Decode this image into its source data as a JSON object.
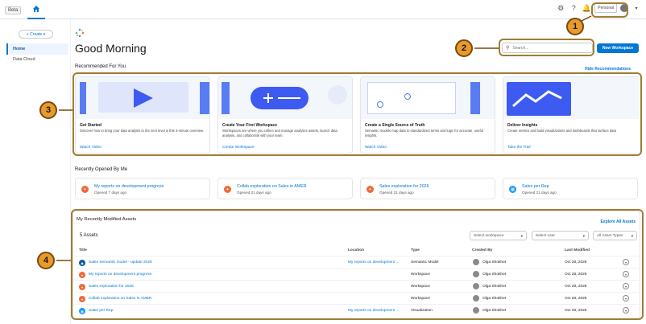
{
  "topbar": {
    "beta": "Beta",
    "personal": "Personal"
  },
  "sidebar": {
    "create": "+ Create",
    "items": [
      {
        "label": "Home"
      },
      {
        "label": "Data Cloud"
      }
    ]
  },
  "greeting": "Good Morning",
  "search": {
    "placeholder": "Search..."
  },
  "new_workspace": "New Workspace",
  "recommended": {
    "title": "Recommended For You",
    "hide": "Hide Recommendations",
    "cards": [
      {
        "title": "Get Started",
        "desc": "Discover how to bring your data analysis to the next level in this 3-minute overview.",
        "link": "Watch Video"
      },
      {
        "title": "Create Your First Workspace",
        "desc": "Workspaces are where you collect and manage analytics assets, launch data analysis, and collaborate with your team.",
        "link": "Create Workspace"
      },
      {
        "title": "Create a Single Source of Truth",
        "desc": "Semantic models map data to standardized terms and logic for accurate, useful insights.",
        "link": "Watch Video"
      },
      {
        "title": "Deliver Insights",
        "desc": "Create metrics and build visualizations and dashboards that surface data",
        "link": "Take the Trail"
      }
    ]
  },
  "recent": {
    "title": "Recently Opened By Me",
    "items": [
      {
        "title": "My reports on development progress",
        "sub": "Opened 7 days ago"
      },
      {
        "title": "Collab exploration on Sales in AMER",
        "sub": "Opened 21 days ago"
      },
      {
        "title": "Sales exploration for 2026",
        "sub": "Opened 21 days ago"
      },
      {
        "title": "Sales per Rep",
        "sub": "Opened 21 days ago"
      }
    ]
  },
  "assets": {
    "title": "My Recently Modified Assets",
    "explore": "Explore All Assets",
    "count": "5 Assets",
    "filters": {
      "workspace": "Select workspace",
      "user": "Select user",
      "types": "All Asset Types"
    },
    "columns": [
      "Title",
      "Location",
      "Type",
      "Created By",
      "Last Modified"
    ],
    "rows": [
      {
        "title": "Sales Semantic model - update 2026",
        "location": "My reports on development ...",
        "type": "Semantic Model",
        "created_by": "Olga Shokhet",
        "modified": "Oct 28, 2025"
      },
      {
        "title": "My reports on development progress",
        "location": "",
        "type": "Workspace",
        "created_by": "Olga Shokhet",
        "modified": "Oct 28, 2025"
      },
      {
        "title": "Sales exploration for 2026",
        "location": "",
        "type": "Workspace",
        "created_by": "Olga Shokhet",
        "modified": "Oct 28, 2025"
      },
      {
        "title": "Collab exploration on Sales in AMER",
        "location": "",
        "type": "Workspace",
        "created_by": "Olga Shokhet",
        "modified": "Oct 28, 2025"
      },
      {
        "title": "Sales per Rep",
        "location": "My reports on development ...",
        "type": "Visualization",
        "created_by": "Olga Shokhet",
        "modified": "Oct 28, 2025"
      }
    ]
  },
  "callouts": [
    "1",
    "2",
    "3",
    "4"
  ],
  "colors": {
    "accent": "#0176d3",
    "callout": "#e89b2c",
    "workspace_icon": "#f06a3a",
    "viz_icon": "#1b96ff",
    "semantic_icon": "#0b5cab"
  }
}
